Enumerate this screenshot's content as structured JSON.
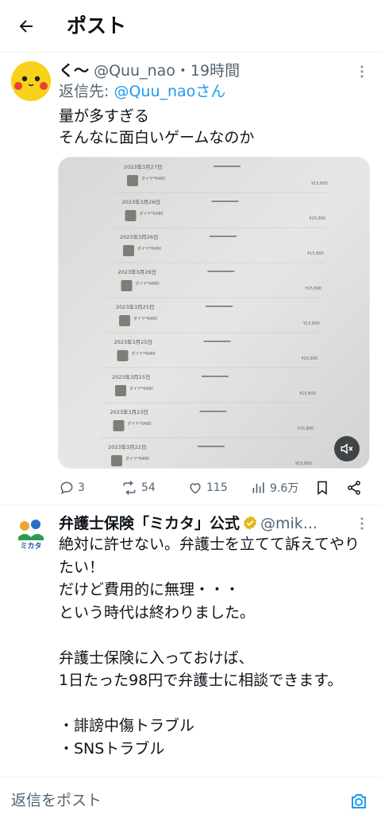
{
  "header": {
    "title": "ポスト"
  },
  "tweet1": {
    "author_name": "く〜",
    "author_handle": "@Quu_nao",
    "time": "・19時間",
    "reply_prefix": "返信先: ",
    "reply_to": "@Quu_naoさん",
    "text": "量が多すぎる\nそんなに面白いゲームなのか",
    "media": {
      "rows": [
        {
          "date": "2023年3月27日",
          "item": "ダイヤ*6480",
          "price": "¥15,800"
        },
        {
          "date": "2023年3月26日",
          "item": "ダイヤ*6480",
          "price": "¥15,800"
        },
        {
          "date": "2023年3月26日",
          "item": "ダイヤ*6480",
          "price": "¥15,800"
        },
        {
          "date": "2023年3月26日",
          "item": "ダイヤ*6480",
          "price": "¥15,800"
        },
        {
          "date": "2023年3月25日",
          "item": "ダイヤ*6480",
          "price": "¥15,800"
        },
        {
          "date": "2023年3月25日",
          "item": "ダイヤ*6480",
          "price": "¥15,800"
        },
        {
          "date": "2023年3月25日",
          "item": "ダイヤ*6480",
          "price": "¥15,800"
        },
        {
          "date": "2023年3月23日",
          "item": "ダイヤ*6480",
          "price": "¥15,800"
        },
        {
          "date": "2023年3月22日",
          "item": "ダイヤ*6480",
          "price": "¥15,800"
        }
      ]
    },
    "stats": {
      "replies": "3",
      "reposts": "54",
      "likes": "115",
      "views": "9.6万"
    }
  },
  "tweet2": {
    "author_name": "弁護士保険「ミカタ」公式",
    "author_handle": "@mik...",
    "logo_text": "ミカタ",
    "text": "絶対に許せない。弁護士を立てて訴えてやりたい！\nだけど費用的に無理・・・\nという時代は終わりました。\n\n弁護士保険に入っておけば、\n1日たった98円で弁護士に相談できます。\n\n・誹謗中傷トラブル\n・SNSトラブル"
  },
  "reply_bar": {
    "placeholder": "返信をポスト"
  },
  "colors": {
    "accent": "#1d9bf0",
    "muted": "#536471",
    "verified_gold": "#e2b719"
  }
}
